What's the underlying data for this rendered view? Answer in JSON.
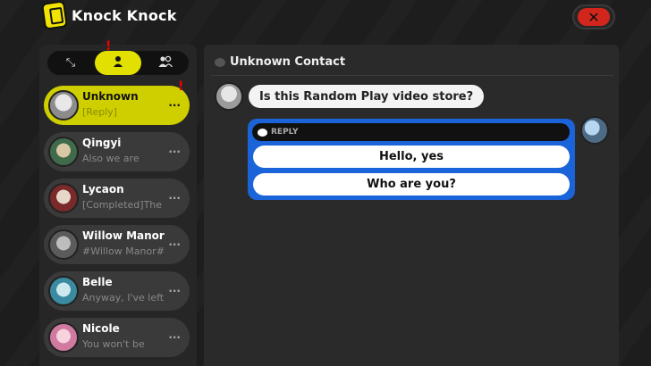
{
  "app": {
    "title": "Knock Knock",
    "close_label": "✕"
  },
  "tabs": [
    {
      "icon": "chat-icon",
      "glyph": "⤡"
    },
    {
      "icon": "person-icon",
      "glyph": "👤",
      "active": true
    },
    {
      "icon": "group-icon",
      "glyph": "👥"
    }
  ],
  "alerts": {
    "tab_alert": "!",
    "contact_alert": "!"
  },
  "contacts": [
    {
      "name": "Unknown",
      "preview": "[Reply]",
      "dots": "...",
      "active": true
    },
    {
      "name": "Qingyi",
      "preview": "Also   we are",
      "dots": "..."
    },
    {
      "name": "Lycaon",
      "preview": "[Completed]The",
      "dots": "..."
    },
    {
      "name": "Willow Manor",
      "preview": "#Willow Manor#",
      "dots": "..."
    },
    {
      "name": "Belle",
      "preview": "Anyway, I've left",
      "dots": "..."
    },
    {
      "name": "Nicole",
      "preview": "You won't be",
      "dots": "..."
    }
  ],
  "chat": {
    "contact_name": "Unknown Contact",
    "incoming_message": "Is this Random Play video store?",
    "reply_label": "REPLY",
    "reply_options": [
      "Hello, yes",
      "Who are you?"
    ]
  },
  "colors": {
    "accent_yellow": "#e2e000",
    "reply_blue": "#1b63d8",
    "close_red": "#d2261d"
  }
}
